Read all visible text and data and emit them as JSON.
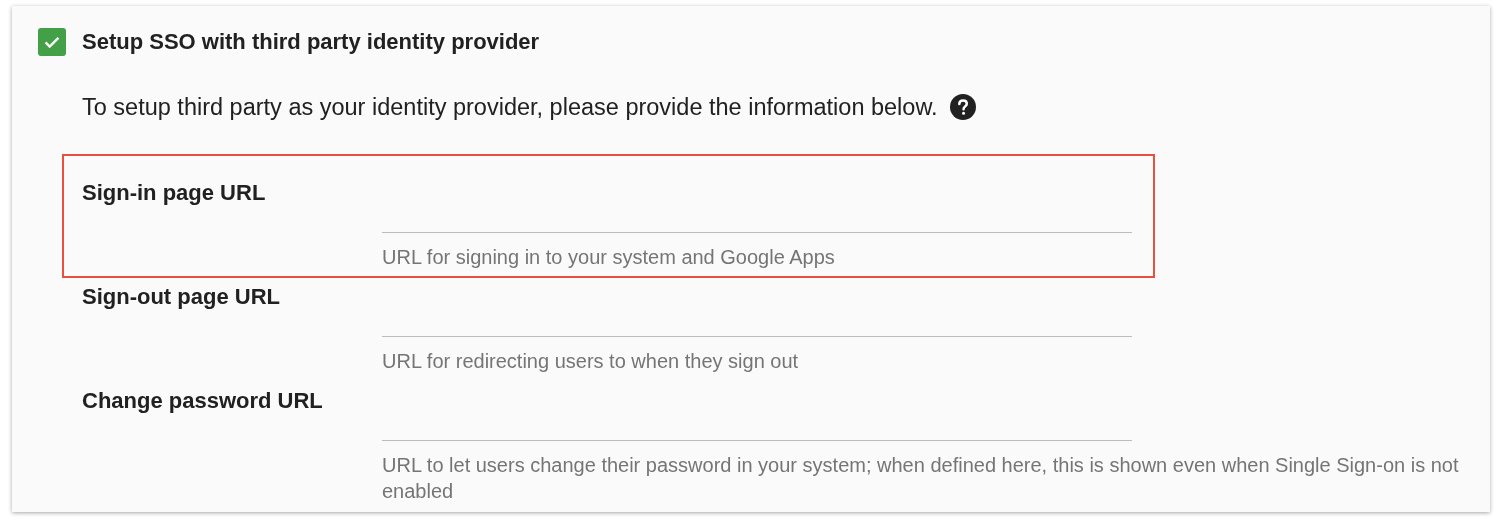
{
  "sso": {
    "label": "Setup SSO with third party identity provider",
    "checked": true
  },
  "description": "To setup third party as your identity provider, please provide the information below.",
  "fields": [
    {
      "label": "Sign-in page URL",
      "hint": "URL for signing in to your system and Google Apps",
      "highlighted": true
    },
    {
      "label": "Sign-out page URL",
      "hint": "URL for redirecting users to when they sign out",
      "highlighted": false
    },
    {
      "label": "Change password URL",
      "hint": "URL to let users change their password in your system; when defined here, this is shown even when Single Sign-on is not enabled",
      "highlighted": false
    }
  ]
}
